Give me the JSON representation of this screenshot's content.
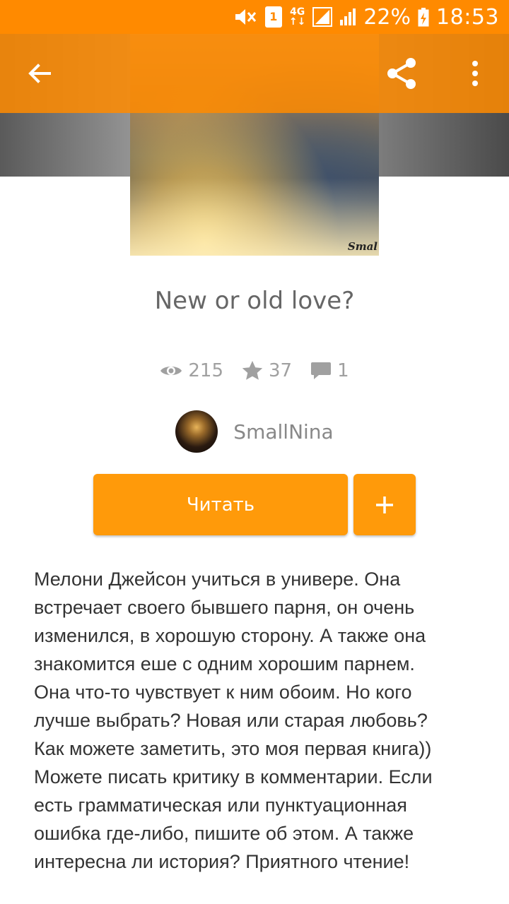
{
  "status_bar": {
    "sim_slot": "1",
    "network_top": "4G",
    "network_bottom": "↑↓",
    "battery_percent": "22%",
    "time": "18:53",
    "icons": [
      "mute-icon",
      "sim-icon",
      "network-4g-icon",
      "signal-icon",
      "battery-charging-icon"
    ]
  },
  "toolbar": {
    "back_icon": "arrow-back-icon",
    "share_icon": "share-icon",
    "more_icon": "more-vert-icon"
  },
  "cover": {
    "watermark": "Smal"
  },
  "story": {
    "title": "New or old love?",
    "views": "215",
    "votes": "37",
    "comments": "1"
  },
  "author": {
    "name": "SmallNina"
  },
  "actions": {
    "read_label": "Читать",
    "add_icon": "plus-icon"
  },
  "description": "Мелони Джейсон учиться в универе. Она\nвстречает своего бывшего парня, он очень\nизменился, в хорошую сторону. А также она\nзнакомится еше с одним хорошим парнем.\nОна что-то чувствует к ним обоим. Но кого\nлучше выбрать? Новая или старая любовь?\nКак можете заметить, это моя первая книга))\nМожете писать критику в комментарии. Если\nесть грамматическая или пунктуационная\nошибка где-либо, пишите об этом. А также\nинтересна ли история? Приятного чтение!",
  "colors": {
    "accent": "#ff8a00",
    "button": "#ff9a0a",
    "text": "#333333",
    "muted": "#a0a0a0"
  }
}
